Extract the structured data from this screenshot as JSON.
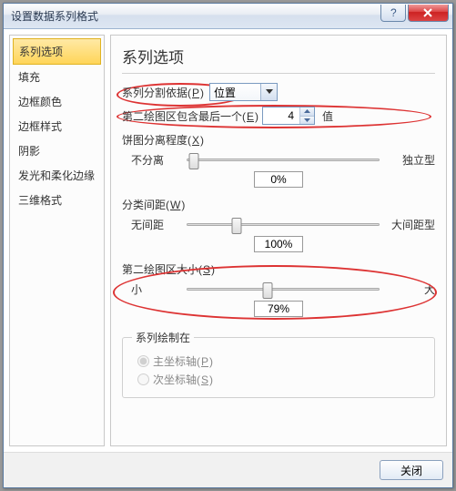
{
  "window": {
    "title": "设置数据系列格式"
  },
  "sidebar": {
    "items": [
      {
        "label": "系列选项",
        "selected": true
      },
      {
        "label": "填充"
      },
      {
        "label": "边框颜色"
      },
      {
        "label": "边框样式"
      },
      {
        "label": "阴影"
      },
      {
        "label": "发光和柔化边缘"
      },
      {
        "label": "三维格式"
      }
    ]
  },
  "main": {
    "heading": "系列选项",
    "split": {
      "label": "系列分割依据(",
      "mn": "P",
      "label2": ")",
      "combo_value": "位置"
    },
    "second": {
      "label": "第二绘图区包含最后一个(",
      "mn": "E",
      "label2": ")",
      "value": "4",
      "suffix": "值"
    },
    "explode": {
      "label": "饼图分离程度(",
      "mn": "X",
      "label2": ")",
      "left": "不分离",
      "right": "独立型",
      "value": "0%",
      "pos": 4
    },
    "gap": {
      "label": "分类间距(",
      "mn": "W",
      "label2": ")",
      "left": "无间距",
      "right": "大间距型",
      "value": "100%",
      "pos": 26
    },
    "size": {
      "label": "第二绘图区大小(",
      "mn": "S",
      "label2": ")",
      "left": "小",
      "right": "大",
      "value": "79%",
      "pos": 42
    },
    "ploton": {
      "legend": "系列绘制在",
      "primary": {
        "label": "主坐标轴(",
        "mn": "P",
        "label2": ")"
      },
      "secondary": {
        "label": "次坐标轴(",
        "mn": "S",
        "label2": ")"
      }
    }
  },
  "footer": {
    "close": "关闭"
  }
}
